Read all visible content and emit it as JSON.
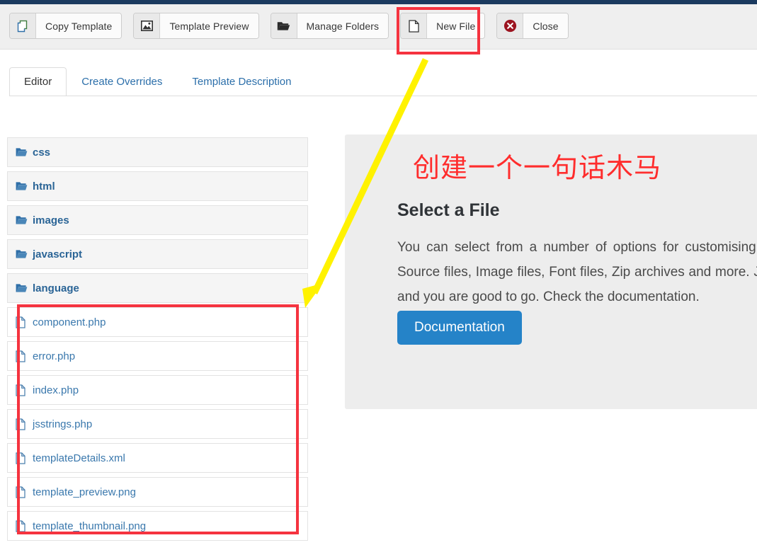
{
  "toolbar": {
    "buttons": [
      {
        "label": "Copy Template",
        "icon": "copy-icon"
      },
      {
        "label": "Template Preview",
        "icon": "image-icon"
      },
      {
        "label": "Manage Folders",
        "icon": "folder-open-icon"
      },
      {
        "label": "New File",
        "icon": "file-icon"
      },
      {
        "label": "Close",
        "icon": "close-circle-icon"
      }
    ]
  },
  "tabs": [
    {
      "label": "Editor",
      "active": true
    },
    {
      "label": "Create Overrides",
      "active": false
    },
    {
      "label": "Template Description",
      "active": false
    }
  ],
  "filetree": {
    "folders": [
      {
        "name": "css"
      },
      {
        "name": "html"
      },
      {
        "name": "images"
      },
      {
        "name": "javascript"
      },
      {
        "name": "language"
      }
    ],
    "files": [
      {
        "name": "component.php"
      },
      {
        "name": "error.php"
      },
      {
        "name": "index.php"
      },
      {
        "name": "jsstrings.php"
      },
      {
        "name": "templateDetails.xml"
      },
      {
        "name": "template_preview.png"
      },
      {
        "name": "template_thumbnail.png"
      }
    ]
  },
  "panel": {
    "annotation_cn": "创建一个一句话木马",
    "heading": "Select a File",
    "body": "You can select from a number of options for customising your template. Source files, Image files, Font files, Zip archives and more. Just select a file and you are good to go. Check the documentation.",
    "button_label": "Documentation"
  },
  "annotations": {
    "highlight_color": "#f5333f",
    "arrow_color": "#fff200",
    "chinese_text_color": "#ff2d2d"
  },
  "colors": {
    "topbar": "#1b3a5f",
    "toolbar_bg": "#efefef",
    "panel_bg": "#ededed",
    "primary_button": "#2583c8",
    "link": "#2a6496"
  }
}
